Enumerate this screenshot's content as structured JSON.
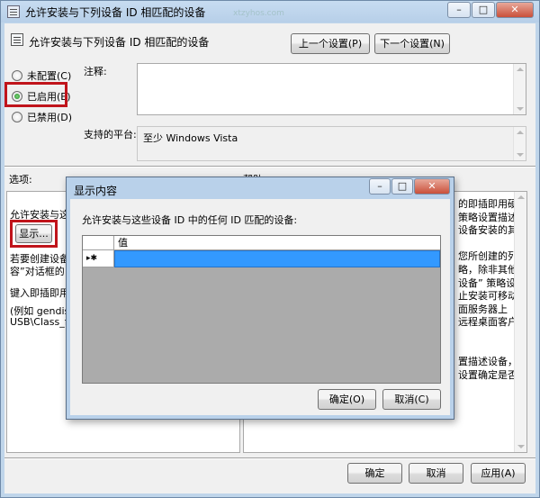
{
  "window": {
    "title": "允许安装与下列设备 ID 相匹配的设备",
    "watermark": "xtzyhos.com",
    "caption": {
      "minimize": "–",
      "maximize": "□",
      "close": "✕"
    }
  },
  "header": {
    "setting_title": "允许安装与下列设备 ID 相匹配的设备",
    "prev_button": "上一个设置(P)",
    "next_button": "下一个设置(N)"
  },
  "state": {
    "not_configured": "未配置(C)",
    "enabled": "已启用(E)",
    "disabled": "已禁用(D)",
    "selected": "enabled"
  },
  "fields": {
    "comment_label": "注释:",
    "comment_value": "",
    "platform_label": "支持的平台:",
    "platform_value": "至少 Windows Vista"
  },
  "sections": {
    "options_label": "选项:",
    "help_label": "帮助:"
  },
  "options": {
    "line1": "允许安装与这",
    "show_button": "显示...",
    "line2": "若要创建设备",
    "line3": "容”对话框的",
    "line4": "键入即插即用",
    "line5": "(例如 gendis",
    "line6": "USB\\Class_ff"
  },
  "help": {
    "lines": [
      "的即插即用硬",
      "策略设置描述",
      "设备安装的其",
      "",
      "您所创建的列",
      "略，除非其他",
      "设备” 策略设",
      "止安装可移动",
      "面服务器上",
      "远程桌面客户",
      "",
      "",
      "置描述设备，",
      "设置确定是否"
    ]
  },
  "footer": {
    "ok": "确定",
    "cancel": "取消",
    "apply": "应用(A)"
  },
  "dialog": {
    "title": "显示内容",
    "caption": {
      "minimize": "–",
      "maximize": "□",
      "close": "✕"
    },
    "prompt": "允许安装与这些设备 ID 中的任何 ID 匹配的设备:",
    "column_header": "值",
    "row_marker": "▸✱",
    "row_value": "",
    "ok": "确定(O)",
    "cancel": "取消(C)"
  },
  "colors": {
    "highlight": "#c0141b",
    "selection": "#3399ff"
  }
}
